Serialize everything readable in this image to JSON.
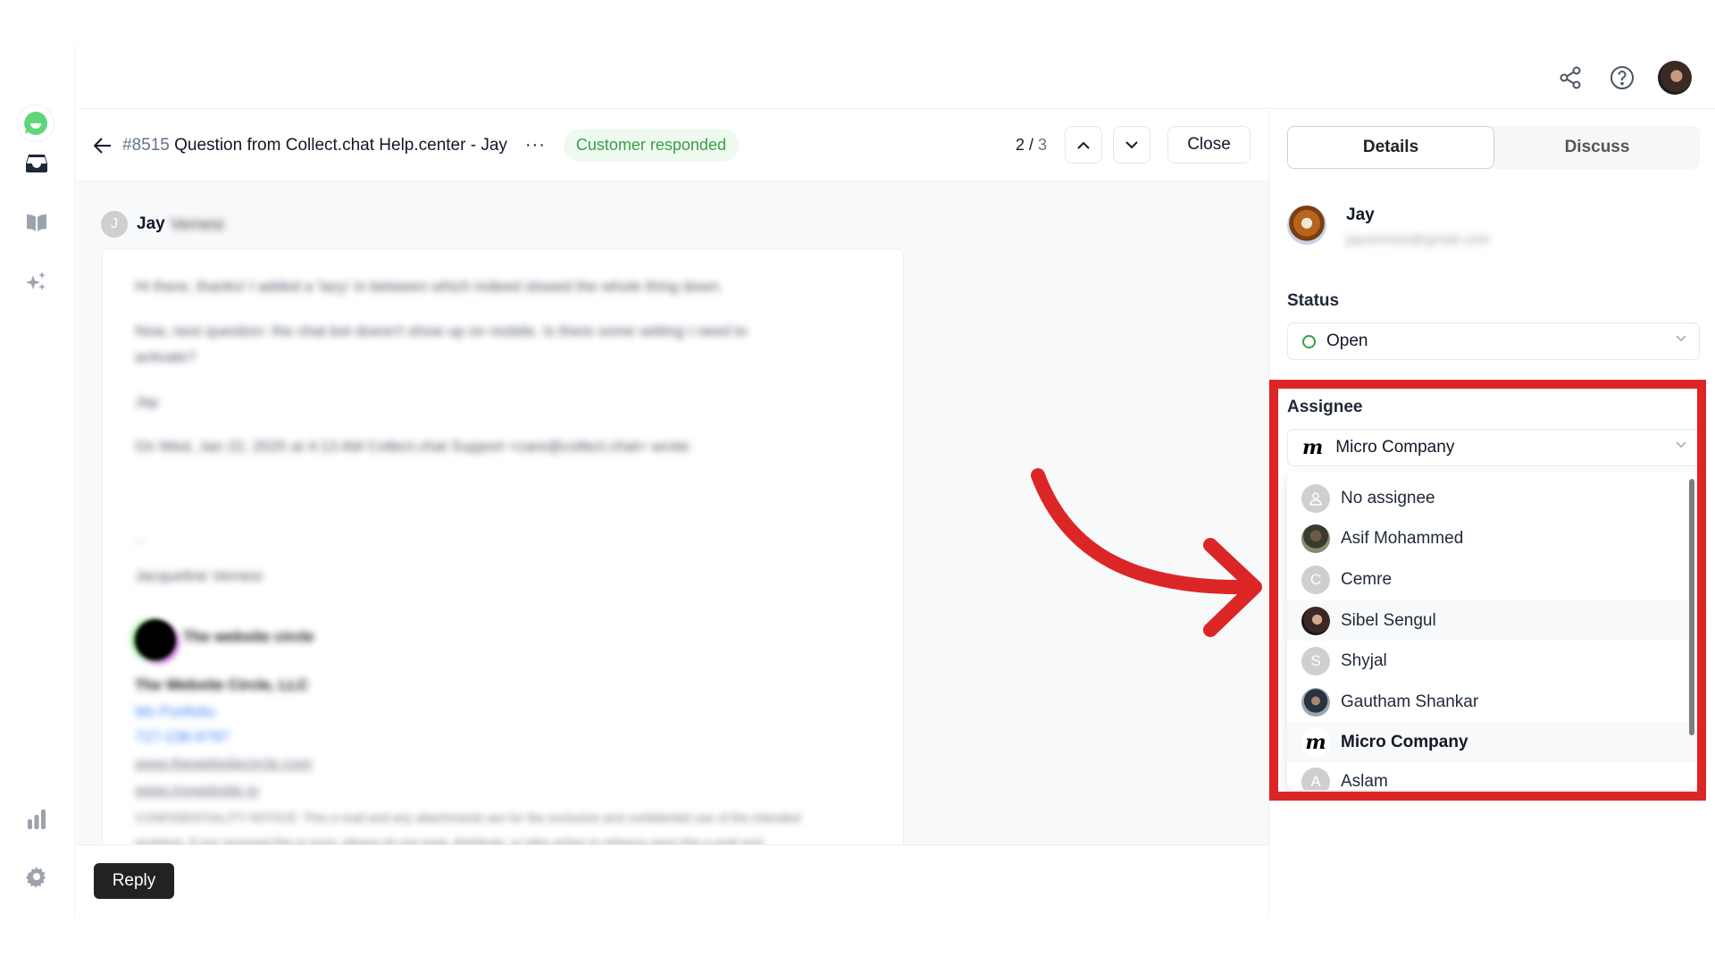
{
  "app": {
    "logo": "collect-chat-logo",
    "brand_color": "#5fd67a",
    "sidebar": {
      "items": [
        {
          "name": "inbox",
          "icon": "inbox-icon",
          "active": true
        },
        {
          "name": "knowledge-base",
          "icon": "book-icon",
          "active": false
        },
        {
          "name": "ai",
          "icon": "sparkles-icon",
          "active": false
        },
        {
          "name": "reports",
          "icon": "bar-chart-icon",
          "active": false
        },
        {
          "name": "settings",
          "icon": "gear-icon",
          "active": false
        }
      ]
    },
    "topbar": {
      "icons": [
        "share-icon",
        "help-icon",
        "user-avatar"
      ]
    }
  },
  "conversation": {
    "id": "#8515",
    "title": "Question from Collect.chat Help.center - Jay",
    "status_badge": "Customer responded",
    "status_color": "#3c9b4a",
    "pager": {
      "current": "2",
      "separator": " / ",
      "total": "3"
    },
    "close_label": "Close",
    "sender": {
      "initial": "J",
      "first_name": "Jay",
      "last_name": "Vernesi"
    },
    "message_lines": [
      "Hi there, thanks! I added a 'lazy' in between which indeed slowed the whole thing down.",
      "Now, next question: the chat bot doesn't show up on mobile. Is there some setting I need to",
      "activate?",
      "Jay",
      "On Wed, Jan 22, 2025 at 4:13 AM Collect.chat Support <care@collect.chat> wrote:",
      "--",
      "Jacqueline Vernesi",
      "The website circle",
      "The Website Circle, LLC",
      "Ms Portfolio",
      "727-238-9797",
      "www.thewebsitecircle.com",
      "www.mywebsite.io",
      "CONFIDENTIALITY NOTICE: This e-mail and any attachments are for the exclusive and confidential use of the intended",
      "recipient. If you received this in error, please do not read, distribute, or take action in reliance upon this e-mail and"
    ],
    "reply_label": "Reply"
  },
  "details_panel": {
    "tabs": [
      {
        "label": "Details",
        "active": true
      },
      {
        "label": "Discuss",
        "active": false
      }
    ],
    "contact": {
      "name": "Jay",
      "email": "jayvernesi@gmail.com"
    },
    "status": {
      "label": "Status",
      "value": "Open"
    },
    "assignee": {
      "label": "Assignee",
      "value": "Micro Company",
      "options": [
        {
          "name": "No assignee",
          "avatar": "user-placeholder",
          "initial": ""
        },
        {
          "name": "Asif Mohammed",
          "avatar": "photo",
          "initial": ""
        },
        {
          "name": "Cemre",
          "avatar": "initial",
          "initial": "C"
        },
        {
          "name": "Sibel Sengul",
          "avatar": "photo",
          "initial": ""
        },
        {
          "name": "Shyjal",
          "avatar": "initial",
          "initial": "S"
        },
        {
          "name": "Gautham Shankar",
          "avatar": "photo",
          "initial": ""
        },
        {
          "name": "Micro Company",
          "avatar": "logo",
          "initial": "m",
          "selected": true
        },
        {
          "name": "Aslam",
          "avatar": "initial",
          "initial": "A"
        }
      ]
    }
  },
  "annotation": {
    "color": "#dc2626",
    "target": "assignee-dropdown"
  }
}
